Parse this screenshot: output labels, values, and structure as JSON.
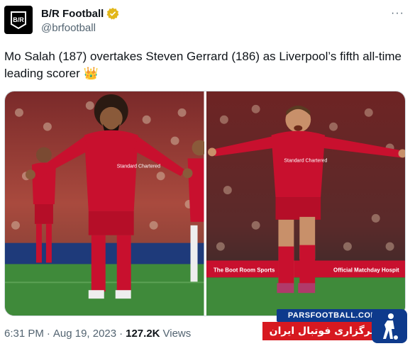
{
  "header": {
    "display_name": "B/R Football",
    "handle": "@brfootball",
    "avatar_text": "B/R",
    "verified_color": "#e2b719",
    "more_label": "···"
  },
  "tweet": {
    "text": "Mo Salah (187) overtakes Steven Gerrard (186) as Liverpool’s fifth all-time leading scorer 👑"
  },
  "media": {
    "photos": [
      {
        "subject": "salah-celebration"
      },
      {
        "subject": "gerrard-celebration"
      }
    ],
    "signs": {
      "standard_chartered": "Standard Chartered",
      "boot_room": "The Boot Room Sports",
      "matchday": "Official Matchday Hospit"
    }
  },
  "footer": {
    "time": "6:31 PM",
    "separator": "·",
    "date": "Aug 19, 2023",
    "views_count": "127.2K",
    "views_label": "Views"
  },
  "watermark": {
    "site": "PARSFOOTBALL.COM",
    "tagline": "خبرگزاری فوتبال ایران"
  },
  "colors": {
    "liverpool_red": "#c8102e",
    "watermark_blue": "#0e3a8c",
    "watermark_red": "#d71920"
  }
}
